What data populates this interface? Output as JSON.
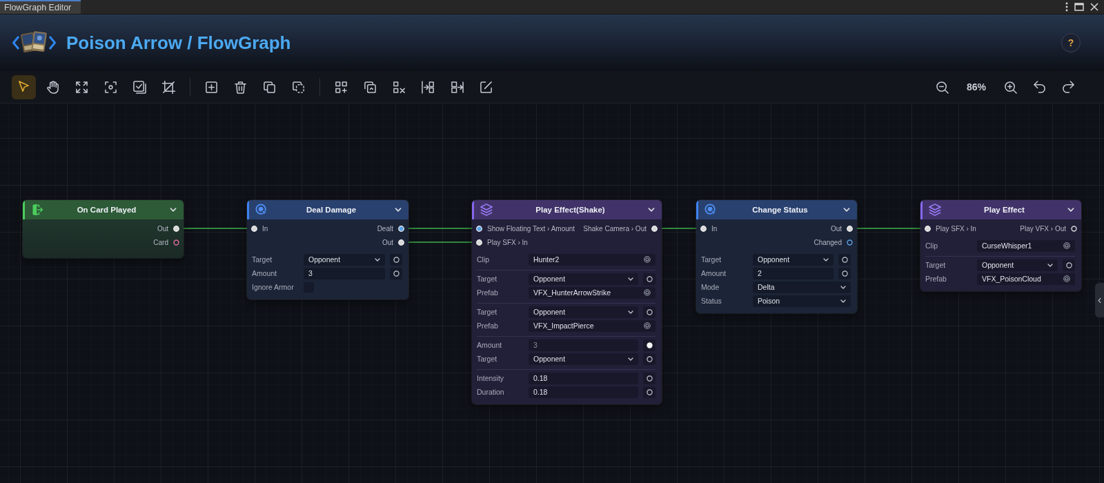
{
  "tabs": [
    {
      "label": "FlowGraph Editor",
      "selected": true
    }
  ],
  "header": {
    "title": "Poison Arrow / FlowGraph",
    "help_label": "?"
  },
  "toolbar": {
    "tool_groups": [
      [
        {
          "kind": "pointer",
          "selected": true
        },
        {
          "kind": "hand",
          "selected": false
        },
        {
          "kind": "expand",
          "selected": false
        },
        {
          "kind": "focus",
          "selected": false
        },
        {
          "kind": "check",
          "selected": false
        },
        {
          "kind": "crop",
          "selected": false
        }
      ],
      [
        {
          "kind": "add",
          "selected": false
        },
        {
          "kind": "delete",
          "selected": false
        },
        {
          "kind": "copy",
          "selected": false
        },
        {
          "kind": "dashed-copy",
          "selected": false
        }
      ],
      [
        {
          "kind": "grid-add",
          "selected": false
        },
        {
          "kind": "swap",
          "selected": false
        },
        {
          "kind": "remove",
          "selected": false
        },
        {
          "kind": "insert",
          "selected": false
        },
        {
          "kind": "extract",
          "selected": false
        },
        {
          "kind": "edit",
          "selected": false
        }
      ]
    ],
    "zoom": "86%"
  },
  "nodes": [
    {
      "kind": "event",
      "title": "On Card Played",
      "expanded": true,
      "port_rows": [
        {
          "out": {
            "label": "Out",
            "color": "#d8d8d8",
            "connected": true
          }
        },
        {
          "out": {
            "label": "Card",
            "color": "#e06a9e",
            "connected": false
          }
        }
      ]
    },
    {
      "kind": "action",
      "title": "Deal Damage",
      "expanded": true,
      "port_rows": [
        {
          "in": {
            "label": "In",
            "color": "#d8d8d8",
            "connected": true
          },
          "out": {
            "label": "Dealt",
            "color": "#5aa2e6",
            "connected": true
          }
        },
        {
          "out": {
            "label": "Out",
            "color": "#d8d8d8",
            "connected": true
          }
        }
      ],
      "field_groups": [
        [
          {
            "label": "Target",
            "kind": "dropdown",
            "value": "Opponent",
            "socket": {
              "connected": false
            }
          },
          {
            "label": "Amount",
            "kind": "text",
            "value": "3",
            "socket": {
              "connected": false
            }
          },
          {
            "label": "Ignore Armor",
            "kind": "checkbox",
            "checked": false
          }
        ]
      ]
    },
    {
      "kind": "effect",
      "title": "Play Effect(Shake)",
      "expanded": true,
      "port_rows": [
        {
          "in": {
            "label": "Show Floating Text › Amount",
            "color": "#5aa2e6",
            "connected": true
          },
          "out": {
            "label": "Shake Camera › Out",
            "color": "#d8d8d8",
            "connected": true
          }
        },
        {
          "in": {
            "label": "Play SFX › In",
            "color": "#d8d8d8",
            "connected": true
          }
        }
      ],
      "field_groups": [
        [
          {
            "label": "Clip",
            "kind": "asset",
            "value": "Hunter2"
          }
        ],
        [
          {
            "label": "Target",
            "kind": "dropdown",
            "value": "Opponent",
            "socket": {
              "connected": false
            }
          },
          {
            "label": "Prefab",
            "kind": "asset",
            "value": "VFX_HunterArrowStrike"
          }
        ],
        [
          {
            "label": "Target",
            "kind": "dropdown",
            "value": "Opponent",
            "socket": {
              "connected": false
            }
          },
          {
            "label": "Prefab",
            "kind": "asset",
            "value": "VFX_ImpactPierce"
          }
        ],
        [
          {
            "label": "Amount",
            "kind": "text",
            "value": "3",
            "socket": {
              "connected": true
            }
          },
          {
            "label": "Target",
            "kind": "dropdown",
            "value": "Opponent",
            "socket": {
              "connected": false
            }
          }
        ],
        [
          {
            "label": "Intensity",
            "kind": "text",
            "value": "0.18",
            "socket": {
              "connected": false
            }
          },
          {
            "label": "Duration",
            "kind": "text",
            "value": "0.18",
            "socket": {
              "connected": false
            }
          }
        ]
      ]
    },
    {
      "kind": "action",
      "title": "Change Status",
      "expanded": true,
      "port_rows": [
        {
          "in": {
            "label": "In",
            "color": "#d8d8d8",
            "connected": true
          },
          "out": {
            "label": "Out",
            "color": "#d8d8d8",
            "connected": true
          }
        },
        {
          "out": {
            "label": "Changed",
            "color": "#5aa2e6",
            "connected": false
          }
        }
      ],
      "field_groups": [
        [
          {
            "label": "Target",
            "kind": "dropdown",
            "value": "Opponent",
            "socket": {
              "connected": false
            }
          },
          {
            "label": "Amount",
            "kind": "text",
            "value": "2",
            "socket": {
              "connected": false
            }
          },
          {
            "label": "Mode",
            "kind": "dropdown",
            "value": "Delta"
          },
          {
            "label": "Status",
            "kind": "dropdown",
            "value": "Poison"
          }
        ]
      ]
    },
    {
      "kind": "effect",
      "title": "Play Effect",
      "expanded": true,
      "port_rows": [
        {
          "in": {
            "label": "Play SFX › In",
            "color": "#d8d8d8",
            "connected": true
          },
          "out": {
            "label": "Play VFX › Out",
            "color": "#d8d8d8",
            "connected": false
          }
        }
      ],
      "field_groups": [
        [
          {
            "label": "Clip",
            "kind": "asset",
            "value": "CurseWhisper1"
          }
        ],
        [
          {
            "label": "Target",
            "kind": "dropdown",
            "value": "Opponent",
            "socket": {
              "connected": false
            }
          },
          {
            "label": "Prefab",
            "kind": "asset",
            "value": "VFX_PoisonCloud"
          }
        ]
      ]
    }
  ]
}
